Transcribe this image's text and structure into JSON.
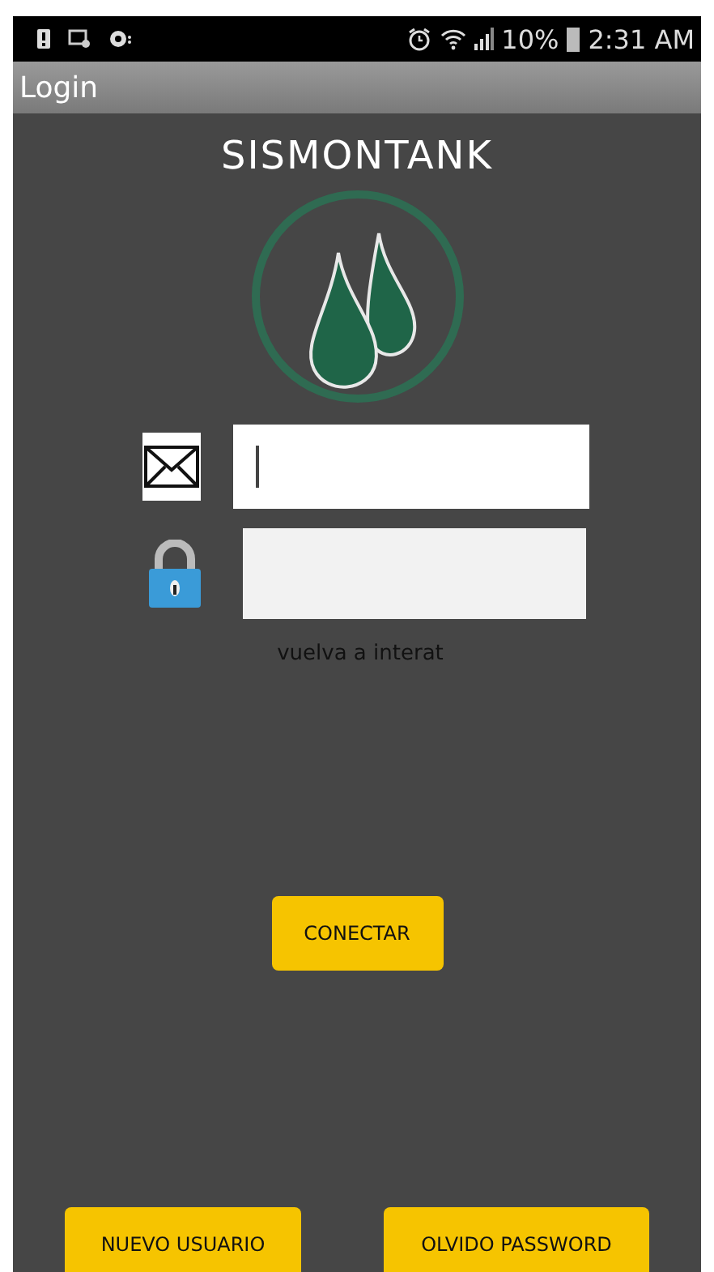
{
  "status_bar": {
    "battery_percent": "10%",
    "time": "2:31 AM"
  },
  "action_bar": {
    "title": "Login"
  },
  "app_title": "SISMONTANK",
  "email_field": {
    "focused": true
  },
  "error_message": "vuelva a interat",
  "connect_button": "CONECTAR",
  "bottom_buttons": [
    "NUEVO USUARIO",
    "OLVIDO PASSWORD"
  ]
}
